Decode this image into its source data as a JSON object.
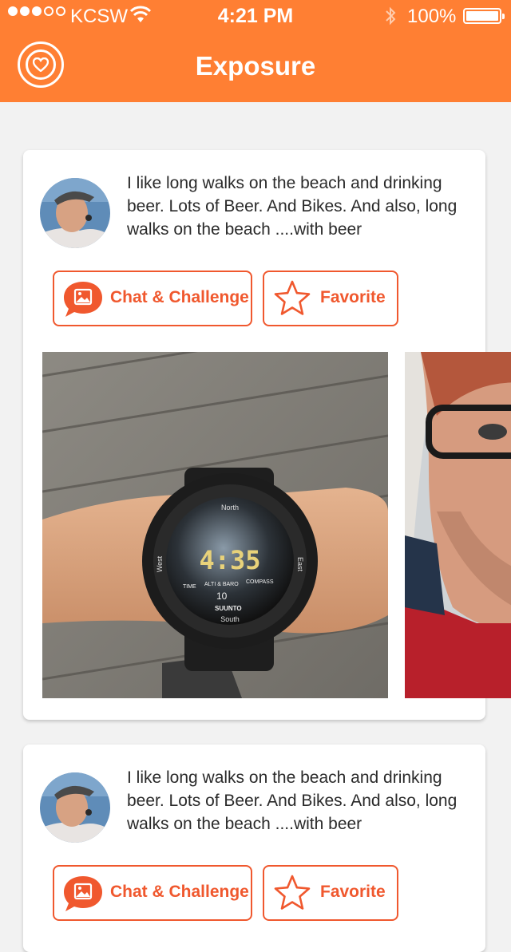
{
  "status_bar": {
    "carrier": "KCSW",
    "time": "4:21 PM",
    "battery": "100%"
  },
  "header": {
    "title": "Exposure",
    "logo_icon": "heart-circle-icon"
  },
  "colors": {
    "header_bg": "#ff7f33",
    "accent": "#f0582e",
    "card_bg": "#ffffff",
    "page_bg": "#f2f2f2"
  },
  "posts": [
    {
      "bio": "I like long walks on the beach and drinking beer. Lots of Beer. And Bikes. And also, long walks on the beach ....with beer",
      "chat_label": "Chat & Challenge",
      "favorite_label": "Favorite",
      "watch": {
        "time": "4:35",
        "north": "North",
        "east": "East",
        "west": "West",
        "south": "South",
        "brand": "SUUNTO",
        "mode_time": "TIME",
        "mode_alti": "ALTI & BARO",
        "mode_compass": "COMPASS",
        "value": "10"
      }
    },
    {
      "bio": "I like long walks on the beach and drinking beer. Lots of Beer. And Bikes. And also, long walks on the beach ....with beer",
      "chat_label": "Chat & Challenge",
      "favorite_label": "Favorite"
    }
  ]
}
